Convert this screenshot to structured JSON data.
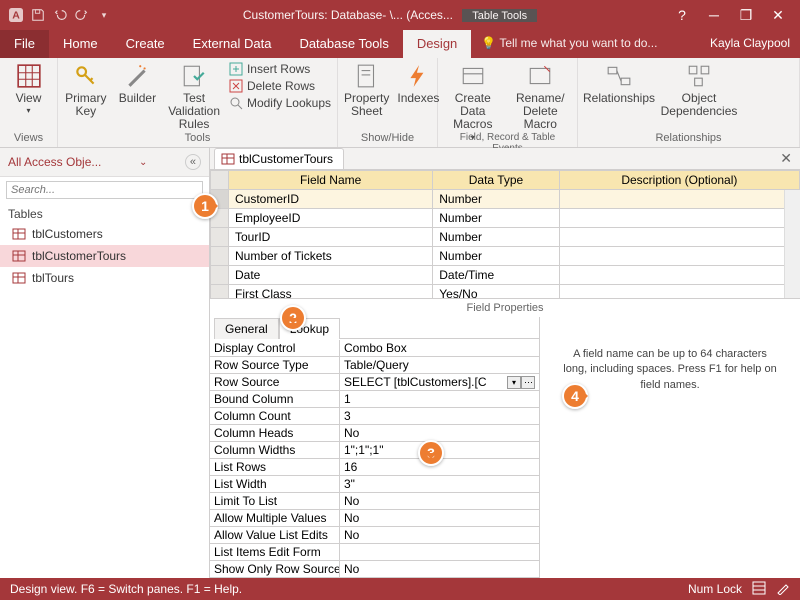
{
  "title": "CustomerTours: Database- \\... (Acces...",
  "tabletools": "Table Tools",
  "user": "Kayla Claypool",
  "tell": "Tell me what you want to do...",
  "menu": [
    "File",
    "Home",
    "Create",
    "External Data",
    "Database Tools",
    "Design"
  ],
  "ribbon": {
    "views": {
      "view": "View",
      "label": "Views"
    },
    "tools": {
      "pk": "Primary Key",
      "builder": "Builder",
      "tv": "Test Validation Rules",
      "ins": "Insert Rows",
      "del": "Delete Rows",
      "mod": "Modify Lookups",
      "label": "Tools"
    },
    "showhide": {
      "prop": "Property Sheet",
      "idx": "Indexes",
      "label": "Show/Hide"
    },
    "events": {
      "macros": "Create Data Macros",
      "rename": "Rename/ Delete Macro",
      "label": "Field, Record & Table Events"
    },
    "rel": {
      "rel": "Relationships",
      "obj": "Object Dependencies",
      "label": "Relationships"
    }
  },
  "nav": {
    "header": "All Access Obje...",
    "search_ph": "Search...",
    "section": "Tables",
    "items": [
      "tblCustomers",
      "tblCustomerTours",
      "tblTours"
    ],
    "activeIndex": 1
  },
  "tab": "tblCustomerTours",
  "grid": {
    "headers": [
      "Field Name",
      "Data Type",
      "Description (Optional)"
    ],
    "rows": [
      {
        "name": "CustomerID",
        "type": "Number"
      },
      {
        "name": "EmployeeID",
        "type": "Number"
      },
      {
        "name": "TourID",
        "type": "Number"
      },
      {
        "name": "Number of Tickets",
        "type": "Number"
      },
      {
        "name": "Date",
        "type": "Date/Time"
      },
      {
        "name": "First Class",
        "type": "Yes/No"
      }
    ]
  },
  "props": {
    "title": "Field Properties",
    "tabs": [
      "General",
      "Lookup"
    ],
    "rows": [
      {
        "n": "Display Control",
        "v": "Combo Box"
      },
      {
        "n": "Row Source Type",
        "v": "Table/Query"
      },
      {
        "n": "Row Source",
        "v": "SELECT [tblCustomers].[C",
        "dd": true,
        "build": true
      },
      {
        "n": "Bound Column",
        "v": "1"
      },
      {
        "n": "Column Count",
        "v": "3"
      },
      {
        "n": "Column Heads",
        "v": "No"
      },
      {
        "n": "Column Widths",
        "v": "1\";1\";1\""
      },
      {
        "n": "List Rows",
        "v": "16"
      },
      {
        "n": "List Width",
        "v": "3\""
      },
      {
        "n": "Limit To List",
        "v": "No"
      },
      {
        "n": "Allow Multiple Values",
        "v": "No"
      },
      {
        "n": "Allow Value List Edits",
        "v": "No"
      },
      {
        "n": "List Items Edit Form",
        "v": ""
      },
      {
        "n": "Show Only Row Source V",
        "v": "No"
      }
    ],
    "help": "A field name can be up to 64 characters long, including spaces. Press F1 for help on field names."
  },
  "status": {
    "left": "Design view.   F6 = Switch panes.   F1 = Help.",
    "numlock": "Num Lock"
  },
  "callouts": [
    "1",
    "2",
    "3",
    "4"
  ]
}
